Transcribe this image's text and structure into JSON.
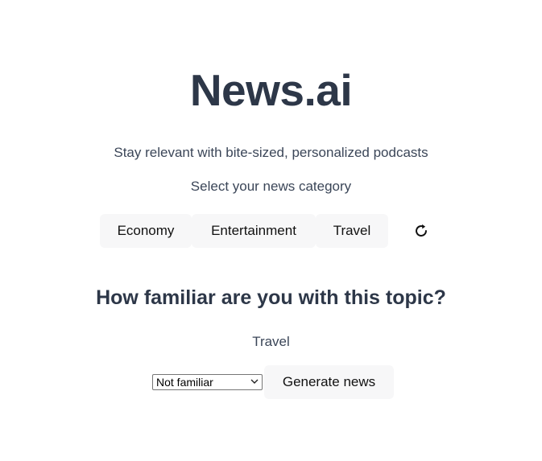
{
  "header": {
    "title": "News.ai",
    "subtitle": "Stay relevant with bite-sized, personalized podcasts"
  },
  "categories": {
    "label": "Select your news category",
    "items": [
      {
        "label": "Economy"
      },
      {
        "label": "Entertainment"
      },
      {
        "label": "Travel"
      }
    ],
    "refresh_icon": "refresh-icon"
  },
  "familiarity": {
    "question": "How familiar are you with this topic?",
    "selected_topic": "Travel",
    "select_value": "Not familiar",
    "generate_label": "Generate news"
  },
  "colors": {
    "heading": "#2d3748",
    "button_bg": "#f7f7f8"
  }
}
